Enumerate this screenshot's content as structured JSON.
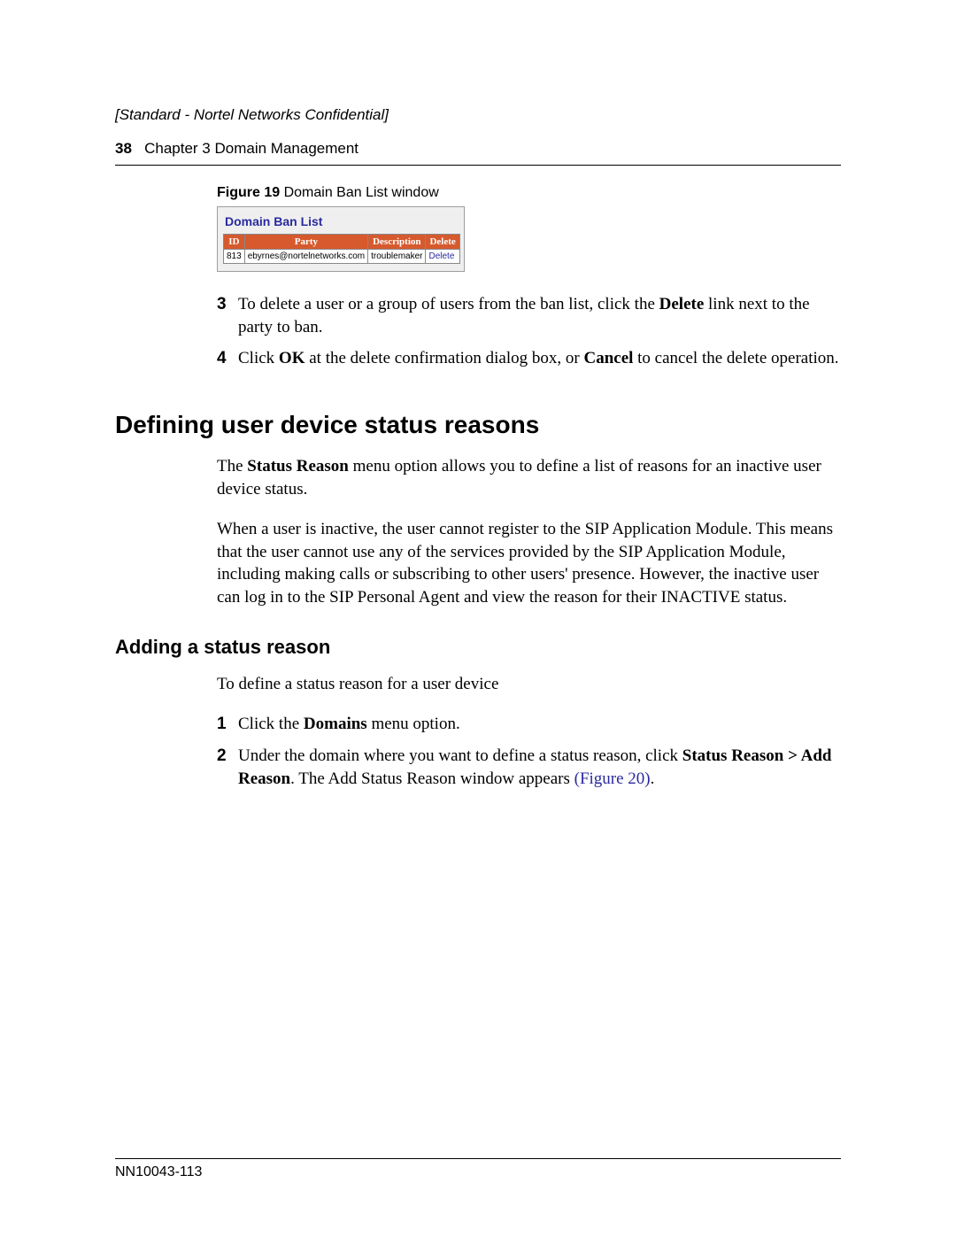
{
  "header": {
    "confidential": "[Standard - Nortel Networks Confidential]",
    "page_number": "38",
    "chapter_label": "Chapter 3  Domain Management"
  },
  "figure19": {
    "label_bold": "Figure 19",
    "label_rest": "   Domain Ban List window",
    "window_title": "Domain Ban List",
    "columns": {
      "id": "ID",
      "party": "Party",
      "description": "Description",
      "delete": "Delete"
    },
    "row": {
      "id": "813",
      "party": "ebyrnes@nortelnetworks.com",
      "description": "troublemaker",
      "delete": "Delete"
    }
  },
  "steps_a": {
    "s3": {
      "num": "3",
      "pre": "To delete a user or a group of users from the ban list, click the ",
      "bold": "Delete",
      "post": " link next to the party to ban."
    },
    "s4": {
      "num": "4",
      "pre": "Click ",
      "b1": "OK",
      "mid": " at the delete confirmation dialog box, or ",
      "b2": "Cancel",
      "post": " to cancel the delete operation."
    }
  },
  "section": {
    "heading": "Defining user device status reasons",
    "p1_pre": "The ",
    "p1_bold": "Status Reason",
    "p1_post": " menu option allows you to define a list of reasons for an inactive user device status.",
    "p2": "When a user is inactive, the user cannot register to the SIP Application Module. This means that the user cannot use any of the services provided by the SIP Application Module, including making calls or subscribing to other users' presence. However, the inactive user can log in to the SIP Personal Agent and view the reason for their INACTIVE status."
  },
  "subsection": {
    "heading": "Adding a status reason",
    "intro": "To define a status reason for a user device",
    "step1": {
      "num": "1",
      "pre": "Click the ",
      "bold": "Domains",
      "post": " menu option."
    },
    "step2": {
      "num": "2",
      "pre": "Under the domain where you want to define a status reason, click ",
      "bold": "Status Reason > Add Reason",
      "post1": ". The Add Status Reason window appears ",
      "figref": "(Figure 20)",
      "post2": "."
    }
  },
  "footer": {
    "doc_id": "NN10043-113"
  }
}
